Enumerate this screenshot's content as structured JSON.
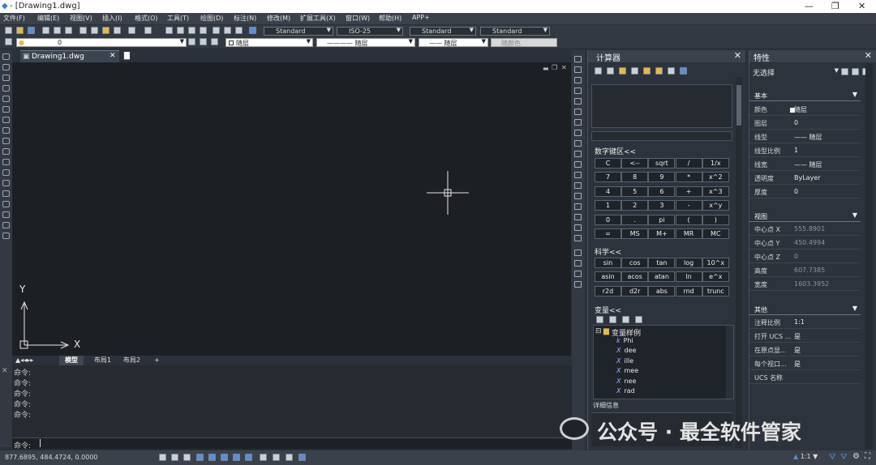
{
  "titlebar": {
    "title": "- [Drawing1.dwg]",
    "minimize": "—",
    "maximize": "❐",
    "close": "✕"
  },
  "menu": [
    "文件(F)",
    "编辑(E)",
    "视图(V)",
    "插入(I)",
    "格式(O)",
    "工具(T)",
    "绘图(D)",
    "标注(N)",
    "修改(M)",
    "扩展工具(X)",
    "窗口(W)",
    "帮助(H)",
    "APP+"
  ],
  "toolbar1": {
    "textstyle": "Standard",
    "dimstyle": "ISO-25",
    "tablestyle": "Standard",
    "mleaderstyle": "Standard"
  },
  "toolbar2": {
    "layer": "0",
    "color": "随层",
    "linetype": "随层",
    "lineweight": "随层",
    "plotstyle": "随颜色"
  },
  "doc_tab": "Drawing1.dwg",
  "axis": {
    "y": "Y",
    "x": "X"
  },
  "layout_tabs": [
    "模型",
    "布局1",
    "布局2",
    "+"
  ],
  "command": {
    "lines": [
      "命令:",
      "命令:",
      "命令:",
      "命令:",
      "命令:"
    ],
    "prompt": "命令:"
  },
  "coords": "877.6895,  484.4724,  0.0000",
  "watermark": "公众号 · 最全软件管家",
  "calculator": {
    "title": "计算器",
    "numpad_title": "数字键区<<",
    "numpad": [
      "C",
      "<--",
      "sqrt",
      "/",
      "1/x",
      "7",
      "8",
      "9",
      "*",
      "x^2",
      "4",
      "5",
      "6",
      "+",
      "x^3",
      "1",
      "2",
      "3",
      "-",
      "x^y",
      "0",
      ".",
      "pi",
      "(",
      ")",
      "=",
      "MS",
      "M+",
      "MR",
      "MC"
    ],
    "sci_title": "科学<<",
    "sci": [
      "sin",
      "cos",
      "tan",
      "log",
      "10^x",
      "asin",
      "acos",
      "atan",
      "ln",
      "e^x",
      "r2d",
      "d2r",
      "abs",
      "rnd",
      "trunc"
    ],
    "var_title": "变量<<",
    "var_root": "变量样例",
    "vars": [
      {
        "k": "k",
        "name": "Phi"
      },
      {
        "k": "X",
        "name": "dee"
      },
      {
        "k": "X",
        "name": "ille"
      },
      {
        "k": "X",
        "name": "mee"
      },
      {
        "k": "X",
        "name": "nee"
      },
      {
        "k": "X",
        "name": "rad"
      }
    ],
    "details": "详细信息"
  },
  "properties": {
    "title": "特性",
    "selection": "无选择",
    "sections": {
      "basic": {
        "title": "基本",
        "rows": [
          [
            "颜色",
            "随层"
          ],
          [
            "图层",
            "0"
          ],
          [
            "线型",
            "—— 随层"
          ],
          [
            "线型比例",
            "1"
          ],
          [
            "线宽",
            "—— 随层"
          ],
          [
            "透明度",
            "ByLayer"
          ],
          [
            "厚度",
            "0"
          ]
        ]
      },
      "view": {
        "title": "视图",
        "rows": [
          [
            "中心点 X",
            "555.8901"
          ],
          [
            "中心点 Y",
            "450.4994"
          ],
          [
            "中心点 Z",
            "0"
          ],
          [
            "高度",
            "607.7385"
          ],
          [
            "宽度",
            "1603.3952"
          ]
        ]
      },
      "other": {
        "title": "其他",
        "rows": [
          [
            "注释比例",
            "1:1"
          ],
          [
            "打开 UCS ...",
            "是"
          ],
          [
            "在原点显...",
            "是"
          ],
          [
            "每个视口...",
            "是"
          ],
          [
            "UCS 名称",
            ""
          ]
        ]
      }
    }
  },
  "status_scale": "1:1",
  "colors": {
    "canvas": "#1c2025",
    "panel": "#2d333c",
    "accent": "#5b8fd4"
  }
}
